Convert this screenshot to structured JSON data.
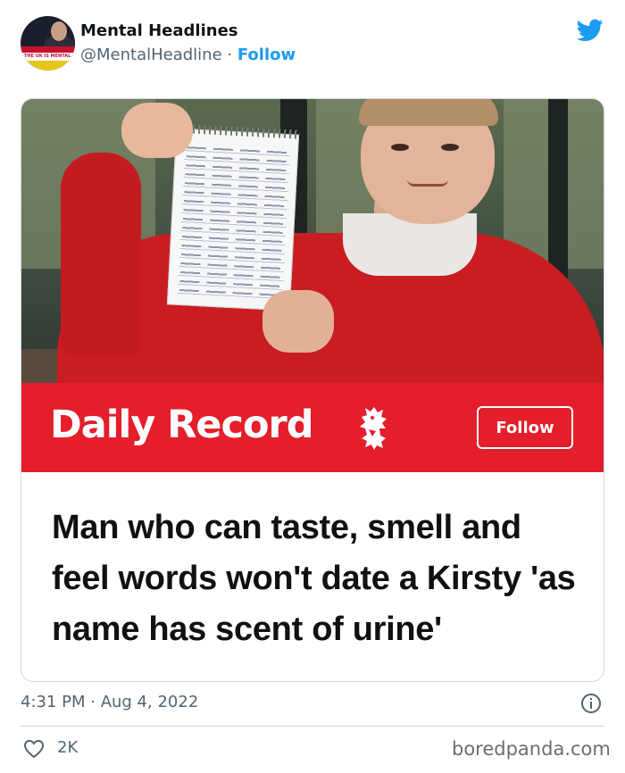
{
  "author": {
    "display_name": "Mental Headlines",
    "handle": "@MentalHeadline",
    "separator": "·",
    "follow_label": "Follow",
    "avatar_text": "THE UK IS MENTAL"
  },
  "card": {
    "publisher": "Daily Record",
    "follow_label": "Follow",
    "headline": "Man who can taste, smell and feel words won't date a Kirsty 'as name has scent of urine'"
  },
  "meta": {
    "timestamp": "4:31 PM · Aug 4, 2022",
    "likes": "2K"
  },
  "watermark": "boredpanda.com",
  "colors": {
    "twitter_blue": "#1d9bf0",
    "daily_record_red": "#e41e2b",
    "text_primary": "#0f1419",
    "text_secondary": "#536471"
  },
  "icons": {
    "platform": "twitter-bird-icon",
    "info": "info-icon",
    "like": "heart-icon",
    "publisher_crest": "lion-crest-icon"
  }
}
